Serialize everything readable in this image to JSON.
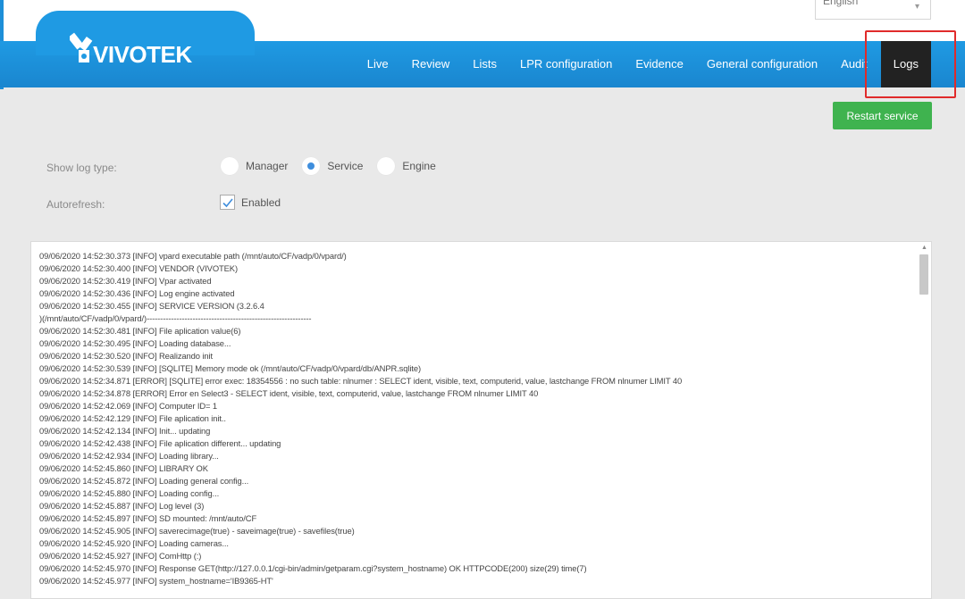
{
  "language_selector": {
    "value": "English"
  },
  "brand": {
    "logo_text": "VIVOTEK",
    "color": "#1f9ae3"
  },
  "nav": {
    "items": [
      {
        "label": "Live"
      },
      {
        "label": "Review"
      },
      {
        "label": "Lists"
      },
      {
        "label": "LPR configuration"
      },
      {
        "label": "Evidence"
      },
      {
        "label": "General configuration"
      },
      {
        "label": "Audit"
      },
      {
        "label": "Logs"
      }
    ],
    "active": "Logs"
  },
  "restart_button": {
    "label": "Restart service",
    "color": "#3fb34f"
  },
  "log_type": {
    "label": "Show log type:",
    "options": [
      "Manager",
      "Service",
      "Engine"
    ],
    "selected": "Service"
  },
  "autorefresh": {
    "label": "Autorefresh:",
    "checkbox_label": "Enabled",
    "checked": true
  },
  "log_lines": [
    "09/06/2020 14:52:30.373 [INFO] vpard executable path (/mnt/auto/CF/vadp/0/vpard/)",
    "09/06/2020 14:52:30.400 [INFO] VENDOR (VIVOTEK)",
    "09/06/2020 14:52:30.419 [INFO] Vpar activated",
    "09/06/2020 14:52:30.436 [INFO] Log engine activated",
    "09/06/2020 14:52:30.455 [INFO] SERVICE VERSION (3.2.6.4",
    ")(/mnt/auto/CF/vadp/0/vpard/)-------------------------------------------------------------",
    "09/06/2020 14:52:30.481 [INFO] File aplication value(6)",
    "09/06/2020 14:52:30.495 [INFO] Loading database...",
    "09/06/2020 14:52:30.520 [INFO] Realizando init",
    "09/06/2020 14:52:30.539 [INFO] [SQLITE] Memory mode ok (/mnt/auto/CF/vadp/0/vpard/db/ANPR.sqlite)",
    "09/06/2020 14:52:34.871 [ERROR] [SQLITE] error exec: 18354556 : no such table: nlnumer : SELECT ident, visible, text, computerid, value, lastchange FROM nlnumer LIMIT 40",
    "09/06/2020 14:52:34.878 [ERROR] Error en Select3 - SELECT ident, visible, text, computerid, value, lastchange FROM nlnumer LIMIT 40",
    "09/06/2020 14:52:42.069 [INFO] Computer ID= 1",
    "09/06/2020 14:52:42.129 [INFO] File aplication init..",
    "09/06/2020 14:52:42.134 [INFO] Init... updating",
    "09/06/2020 14:52:42.438 [INFO] File aplication different... updating",
    "09/06/2020 14:52:42.934 [INFO] Loading library...",
    "09/06/2020 14:52:45.860 [INFO] LIBRARY OK",
    "09/06/2020 14:52:45.872 [INFO] Loading general config...",
    "09/06/2020 14:52:45.880 [INFO] Loading config...",
    "09/06/2020 14:52:45.887 [INFO] Log level (3)",
    "09/06/2020 14:52:45.897 [INFO] SD mounted: /mnt/auto/CF",
    "09/06/2020 14:52:45.905 [INFO] saverecimage(true) - saveimage(true) - savefiles(true)",
    "09/06/2020 14:52:45.920 [INFO] Loading cameras...",
    "09/06/2020 14:52:45.927 [INFO] ComHttp (:)",
    "09/06/2020 14:52:45.970 [INFO] Response GET(http://127.0.0.1/cgi-bin/admin/getparam.cgi?system_hostname) OK HTTPCODE(200) size(29) time(7)",
    "09/06/2020 14:52:45.977 [INFO] system_hostname='IB9365-HT'"
  ]
}
